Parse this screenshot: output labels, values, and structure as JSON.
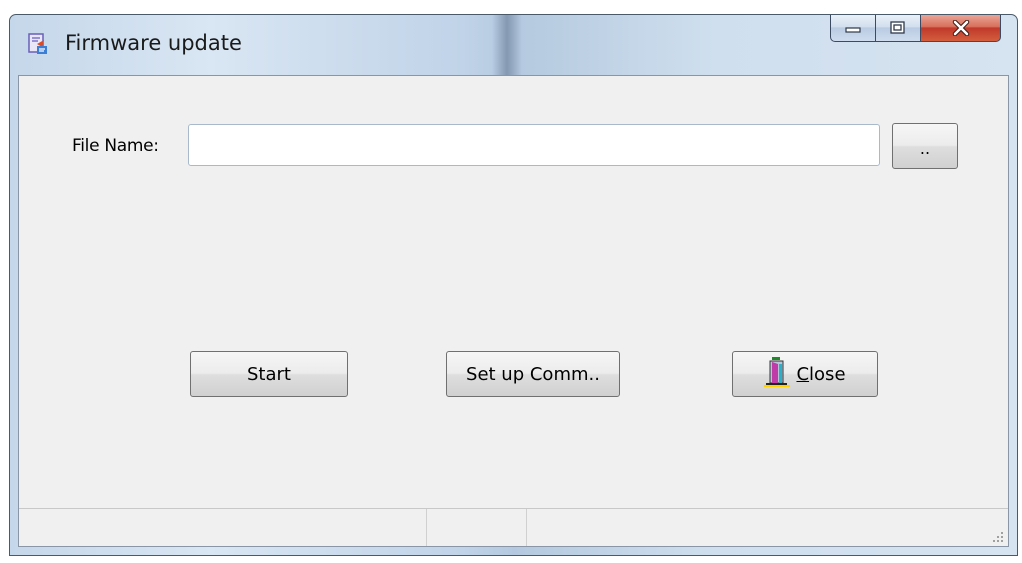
{
  "window": {
    "title": "Firmware update",
    "icon": "firmware-update-app-icon",
    "caption_buttons": [
      "minimize-icon",
      "maximize-icon",
      "close-x-icon"
    ]
  },
  "form": {
    "file_name_label": "File Name:",
    "file_name_value": "",
    "browse_label": ".."
  },
  "buttons": {
    "start": "Start",
    "setup_comm": "Set up Comm..",
    "close_prefix": "",
    "close_mnemonic": "C",
    "close_rest": "lose",
    "close_icon": "door-exit-icon"
  },
  "statusbar": {
    "panes": [
      "",
      "",
      ""
    ]
  },
  "colors": {
    "client_bg": "#f0f0f0",
    "close_caption": "#c0392b",
    "frame": "#c5d7ea"
  }
}
